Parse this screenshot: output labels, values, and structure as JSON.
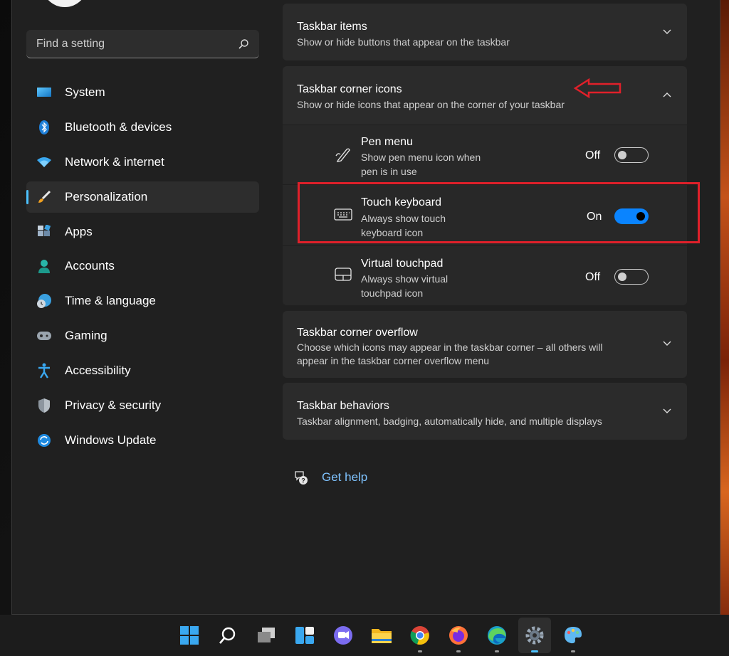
{
  "search": {
    "placeholder": "Find a setting",
    "icon": "search-icon"
  },
  "sidebar": {
    "items": [
      {
        "label": "System",
        "icon": "system-icon",
        "active": false
      },
      {
        "label": "Bluetooth & devices",
        "icon": "bluetooth-icon",
        "active": false
      },
      {
        "label": "Network & internet",
        "icon": "wifi-icon",
        "active": false
      },
      {
        "label": "Personalization",
        "icon": "brush-icon",
        "active": true
      },
      {
        "label": "Apps",
        "icon": "apps-icon",
        "active": false
      },
      {
        "label": "Accounts",
        "icon": "accounts-icon",
        "active": false
      },
      {
        "label": "Time & language",
        "icon": "clock-globe-icon",
        "active": false
      },
      {
        "label": "Gaming",
        "icon": "gamepad-icon",
        "active": false
      },
      {
        "label": "Accessibility",
        "icon": "accessibility-icon",
        "active": false
      },
      {
        "label": "Privacy & security",
        "icon": "shield-icon",
        "active": false
      },
      {
        "label": "Windows Update",
        "icon": "update-icon",
        "active": false
      }
    ]
  },
  "main": {
    "taskbar_items": {
      "title": "Taskbar items",
      "subtitle": "Show or hide buttons that appear on the taskbar"
    },
    "corner_icons": {
      "title": "Taskbar corner icons",
      "subtitle": "Show or hide icons that appear on the corner of your taskbar",
      "rows": [
        {
          "title": "Pen menu",
          "subtitle_1": "Show pen menu icon when",
          "subtitle_2": "pen is in use",
          "state": "Off",
          "on": false,
          "icon": "pen-icon"
        },
        {
          "title": "Touch keyboard",
          "subtitle_1": "Always show touch",
          "subtitle_2": "keyboard icon",
          "state": "On",
          "on": true,
          "icon": "keyboard-icon"
        },
        {
          "title": "Virtual touchpad",
          "subtitle_1": "Always show virtual",
          "subtitle_2": "touchpad icon",
          "state": "Off",
          "on": false,
          "icon": "touchpad-icon"
        }
      ]
    },
    "corner_overflow": {
      "title": "Taskbar corner overflow",
      "subtitle_1": "Choose which icons may appear in the taskbar corner – all others will",
      "subtitle_2": "appear in the taskbar corner overflow menu"
    },
    "behaviors": {
      "title": "Taskbar behaviors",
      "subtitle": "Taskbar alignment, badging, automatically hide, and multiple displays"
    },
    "help": {
      "label": "Get help"
    }
  },
  "colors": {
    "accent": "#0a84ff",
    "highlight": "#e0202a",
    "link": "#7fc3ff"
  },
  "taskbar": {
    "icons": [
      "windows-start-icon",
      "search-icon",
      "task-view-icon",
      "widgets-icon",
      "chat-icon",
      "file-explorer-icon",
      "chrome-icon",
      "firefox-icon",
      "edge-icon",
      "settings-icon",
      "paint-icon"
    ]
  }
}
